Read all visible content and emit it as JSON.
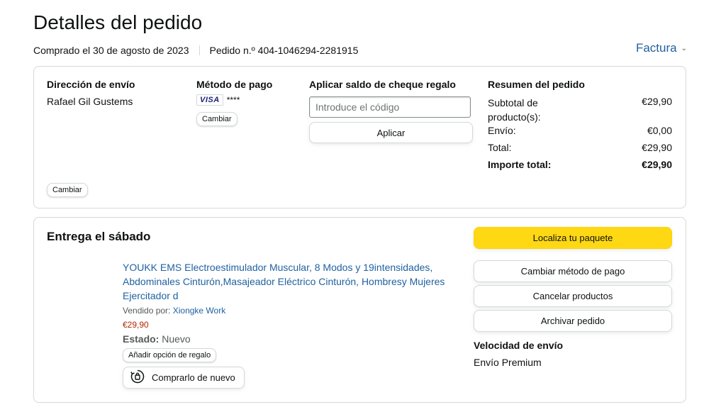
{
  "page": {
    "title": "Detalles del pedido",
    "purchased": "Comprado el 30 de agosto de 2023",
    "order_number": "Pedido n.º 404-1046294-2281915",
    "invoice_label": "Factura"
  },
  "summary_card": {
    "shipping": {
      "heading": "Dirección de envío",
      "name": "Rafael Gil Gustems",
      "change_label": "Cambiar"
    },
    "payment": {
      "heading": "Método de pago",
      "card_brand": "VISA",
      "card_mask": "****",
      "change_label": "Cambiar"
    },
    "gift": {
      "heading": "Aplicar saldo de cheque regalo",
      "placeholder": "Introduce el código",
      "apply_label": "Aplicar"
    },
    "order_summary": {
      "heading": "Resumen del pedido",
      "rows": [
        {
          "label": "Subtotal de producto(s):",
          "value": "€29,90"
        },
        {
          "label": "Envío:",
          "value": "€0,00"
        },
        {
          "label": "Total:",
          "value": "€29,90"
        },
        {
          "label": "Importe total:",
          "value": "€29,90"
        }
      ]
    }
  },
  "delivery_card": {
    "heading": "Entrega el sábado",
    "product": {
      "title": "YOUKK EMS Electroestimulador Muscular, 8 Modos y 19intensidades, Abdominales Cinturón,Masajeador Eléctrico Cinturón, Hombresy Mujeres Ejercitador d",
      "sold_by_label": "Vendido por:",
      "seller": "Xiongke Work",
      "price": "€29,90",
      "status_label": "Estado:",
      "status_value": "Nuevo",
      "gift_option_label": "Añadir opción de regalo",
      "buy_again_label": "Comprarlo de nuevo"
    },
    "actions": {
      "track": "Localiza tu paquete",
      "change_payment": "Cambiar método de pago",
      "cancel": "Cancelar productos",
      "archive": "Archivar pedido"
    },
    "shipping_speed": {
      "heading": "Velocidad de envío",
      "value": "Envío Premium"
    }
  },
  "colors": {
    "link": "#2162a1",
    "primary_button": "#ffd814",
    "price": "#b12704",
    "border": "#d5d9d9"
  },
  "icons": [
    "chevron-down-icon",
    "buy-again-icon",
    "visa-card-icon"
  ]
}
